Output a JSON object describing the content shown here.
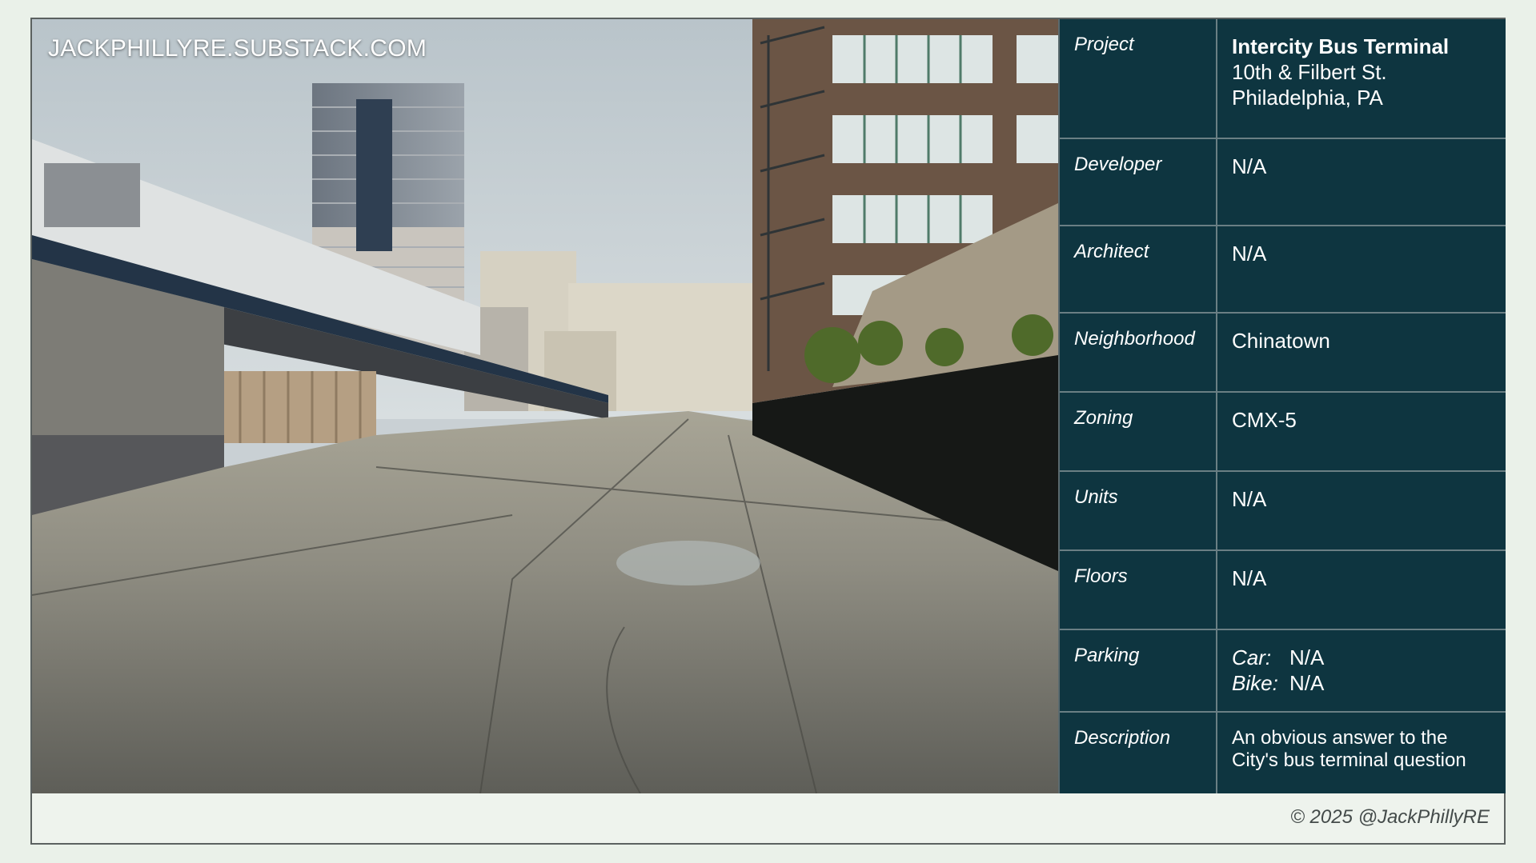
{
  "watermark": "JACKPHILLYRE.SUBSTACK.COM",
  "rows": {
    "project": {
      "label": "Project",
      "name": "Intercity Bus Terminal",
      "address": "10th & Filbert St.",
      "city": "Philadelphia, PA"
    },
    "developer": {
      "label": "Developer",
      "value": "N/A"
    },
    "architect": {
      "label": "Architect",
      "value": "N/A"
    },
    "neighborhood": {
      "label": "Neighborhood",
      "value": "Chinatown"
    },
    "zoning": {
      "label": "Zoning",
      "value": "CMX-5"
    },
    "units": {
      "label": "Units",
      "value": "N/A"
    },
    "floors": {
      "label": "Floors",
      "value": "N/A"
    },
    "parking": {
      "label": "Parking",
      "car_label": "Car:",
      "car_value": "N/A",
      "bike_label": "Bike:",
      "bike_value": "N/A"
    },
    "description": {
      "label": "Description",
      "line1": "An obvious answer to the",
      "line2": "City's bus terminal question"
    }
  },
  "footer": "© 2025 @JackPhillyRE",
  "colors": {
    "table_bg": "#0e3540",
    "page_bg": "#eaf1e9"
  }
}
